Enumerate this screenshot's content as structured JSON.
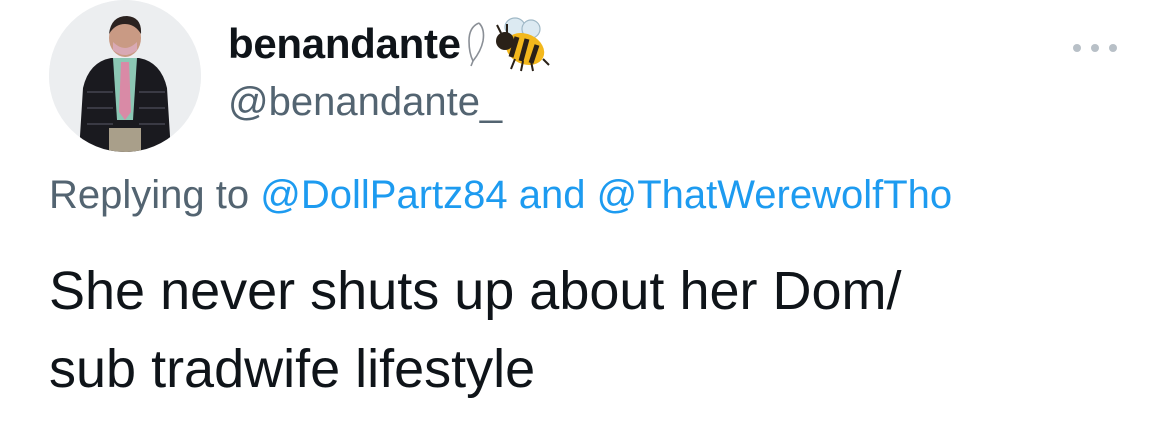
{
  "user": {
    "display_name": "benandante",
    "handle": "@benandante_",
    "name_emojis": [
      "feather-icon",
      "bee-icon"
    ]
  },
  "reply": {
    "prefix": "Replying to",
    "mention_1": "@DollPartz84",
    "conjunction": "and",
    "mention_2": "@ThatWerewolfTho"
  },
  "tweet": {
    "line_1": "She never shuts up about her Dom/",
    "line_2": "sub tradwife lifestyle"
  },
  "colors": {
    "text": "#0f1419",
    "secondary": "#536471",
    "link": "#1d9bf0",
    "more_dots": "#b8c0c7"
  },
  "icons": {
    "more": "more-horizontal-icon"
  }
}
